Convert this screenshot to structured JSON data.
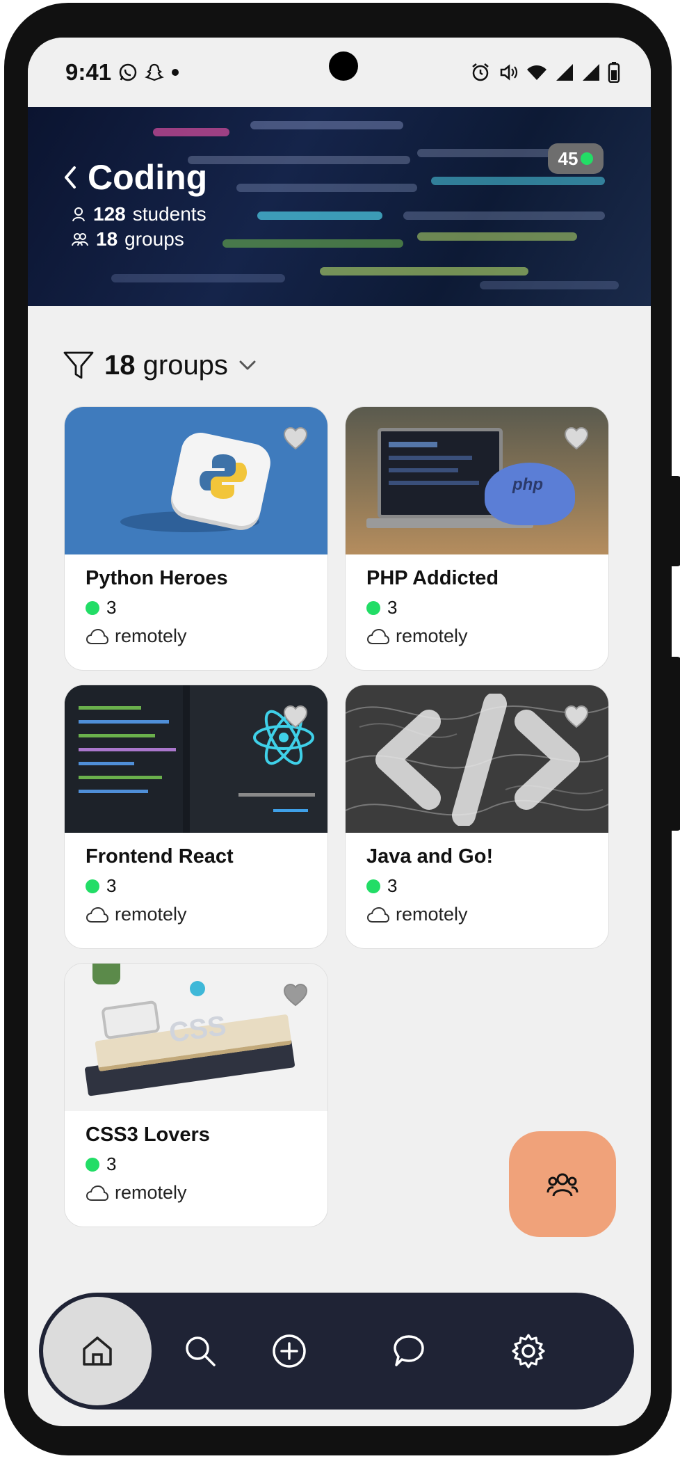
{
  "status_bar": {
    "time": "9:41",
    "left_icons": [
      "whatsapp-icon",
      "snapchat-icon",
      "dot-icon"
    ],
    "right_icons": [
      "alarm-icon",
      "vibrate-icon",
      "wifi-icon",
      "signal-icon",
      "signal-icon",
      "battery-icon"
    ]
  },
  "header": {
    "title": "Coding",
    "students_count": "128",
    "students_label": "students",
    "groups_count": "18",
    "groups_label": "groups",
    "online_count": "45"
  },
  "filter": {
    "count": "18",
    "label": "groups"
  },
  "groups": [
    {
      "title": "Python Heroes",
      "online": "3",
      "location": "remotely",
      "image": "python-logo"
    },
    {
      "title": "PHP Addicted",
      "online": "3",
      "location": "remotely",
      "image": "php-laptop"
    },
    {
      "title": "Frontend React",
      "online": "3",
      "location": "remotely",
      "image": "react-code"
    },
    {
      "title": "Java and Go!",
      "online": "3",
      "location": "remotely",
      "image": "code-brackets"
    },
    {
      "title": "CSS3 Lovers",
      "online": "3",
      "location": "remotely",
      "image": "css-books"
    }
  ],
  "colors": {
    "accent_fab": "#f0a27a",
    "online_green": "#22dd66",
    "nav_bg": "#1f2335",
    "nav_active": "#dcdcdc"
  },
  "bottom_nav": [
    "home-icon",
    "search-icon",
    "add-icon",
    "chat-icon",
    "settings-icon"
  ]
}
